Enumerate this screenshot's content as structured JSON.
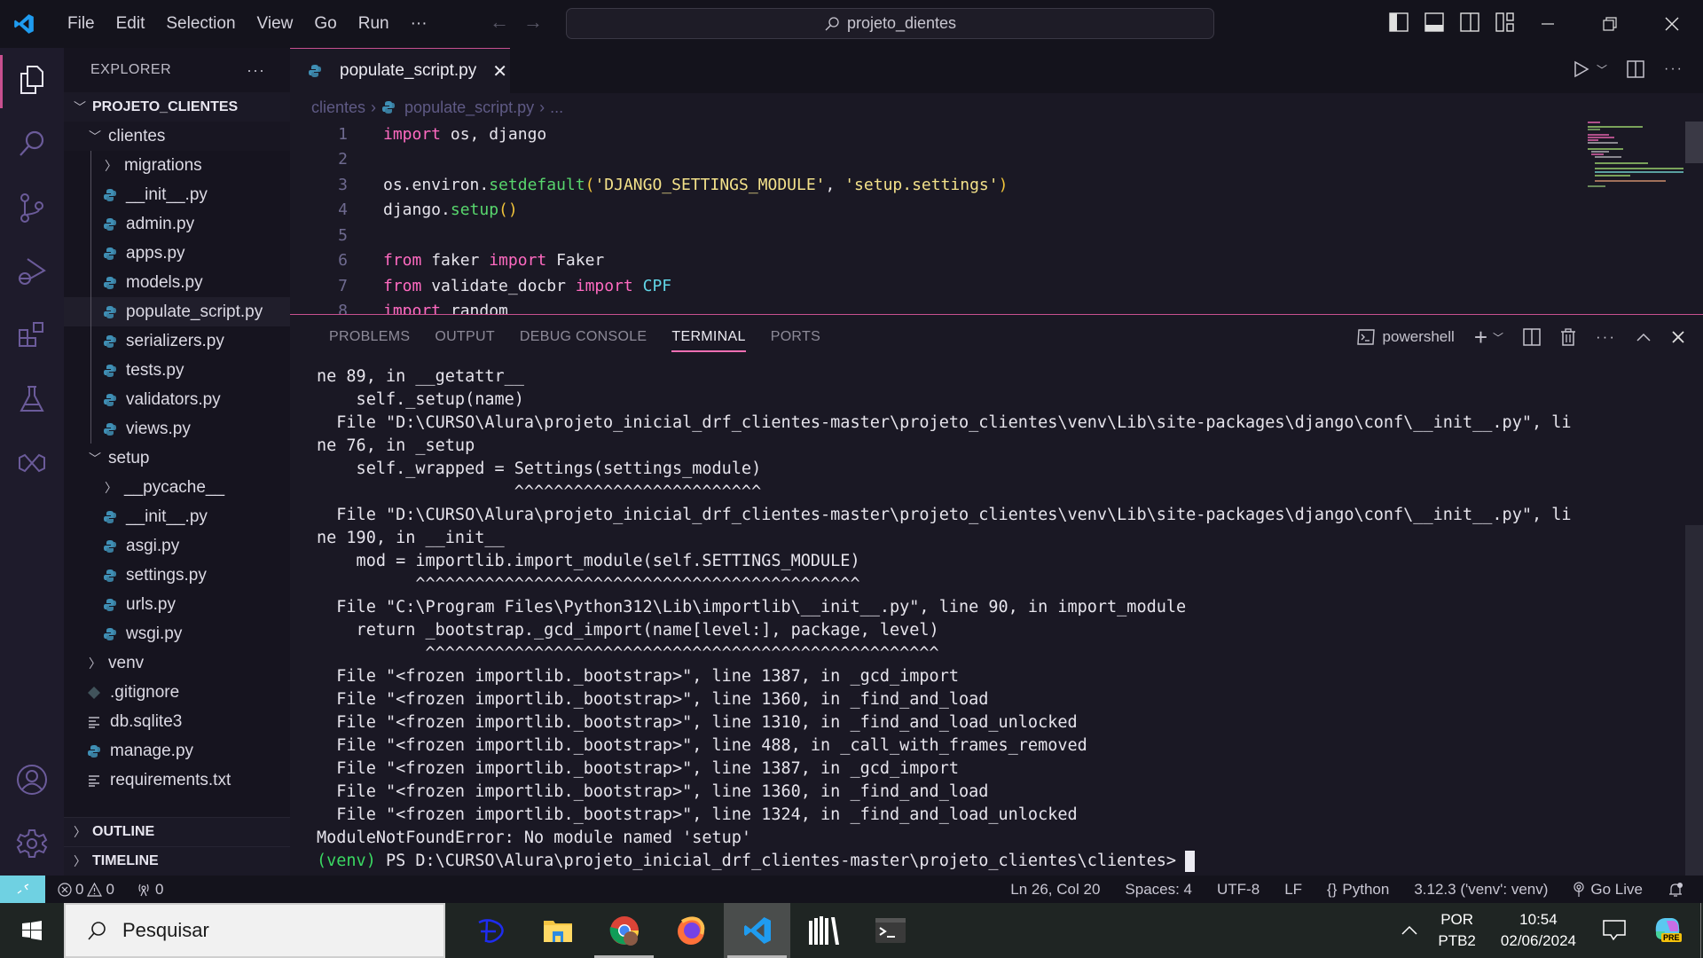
{
  "titlebar": {
    "menu": [
      "File",
      "Edit",
      "Selection",
      "View",
      "Go",
      "Run",
      "···"
    ],
    "search_text": "projeto_dientes"
  },
  "sidebar": {
    "title": "EXPLORER",
    "more": "···",
    "project": "PROJETO_CLIENTES",
    "tree": [
      {
        "label": "clientes",
        "type": "folder-open",
        "level": 1
      },
      {
        "label": "migrations",
        "type": "folder-closed",
        "level": 2
      },
      {
        "label": "__init__.py",
        "type": "py",
        "level": 2
      },
      {
        "label": "admin.py",
        "type": "py",
        "level": 2
      },
      {
        "label": "apps.py",
        "type": "py",
        "level": 2
      },
      {
        "label": "models.py",
        "type": "py",
        "level": 2
      },
      {
        "label": "populate_script.py",
        "type": "py",
        "level": 2,
        "selected": true
      },
      {
        "label": "serializers.py",
        "type": "py",
        "level": 2
      },
      {
        "label": "tests.py",
        "type": "py",
        "level": 2
      },
      {
        "label": "validators.py",
        "type": "py",
        "level": 2
      },
      {
        "label": "views.py",
        "type": "py",
        "level": 2
      },
      {
        "label": "setup",
        "type": "folder-open",
        "level": 1
      },
      {
        "label": "__pycache__",
        "type": "folder-closed",
        "level": 2
      },
      {
        "label": "__init__.py",
        "type": "py",
        "level": 2
      },
      {
        "label": "asgi.py",
        "type": "py",
        "level": 2
      },
      {
        "label": "settings.py",
        "type": "py",
        "level": 2
      },
      {
        "label": "urls.py",
        "type": "py",
        "level": 2
      },
      {
        "label": "wsgi.py",
        "type": "py",
        "level": 2
      },
      {
        "label": "venv",
        "type": "folder-closed",
        "level": 1
      },
      {
        "label": ".gitignore",
        "type": "git",
        "level": 1
      },
      {
        "label": "db.sqlite3",
        "type": "txt",
        "level": 1
      },
      {
        "label": "manage.py",
        "type": "py",
        "level": 1
      },
      {
        "label": "requirements.txt",
        "type": "txt",
        "level": 1
      }
    ],
    "outline": "OUTLINE",
    "timeline": "TIMELINE"
  },
  "editor": {
    "tab_label": "populate_script.py",
    "breadcrumb": [
      "clientes",
      "populate_script.py",
      "..."
    ],
    "lines": [
      {
        "n": "1",
        "html": "<span class='kw'>import</span> os, django"
      },
      {
        "n": "2",
        "html": ""
      },
      {
        "n": "3",
        "html": "os.environ.<span class='fn'>setdefault</span><span class='paren'>(</span><span class='str'>'DJANGO_SETTINGS_MODULE'</span>, <span class='str'>'setup.settings'</span><span class='paren'>)</span>"
      },
      {
        "n": "4",
        "html": "django.<span class='fn'>setup</span><span class='paren'>()</span>"
      },
      {
        "n": "5",
        "html": ""
      },
      {
        "n": "6",
        "html": "<span class='kw'>from</span> faker <span class='kw'>import</span> Faker"
      },
      {
        "n": "7",
        "html": "<span class='kw'>from</span> validate_docbr <span class='kw'>import</span> <span class='cls'>CPF</span>"
      },
      {
        "n": "8",
        "html": "<span class='kw'>import</span> random"
      }
    ]
  },
  "panel": {
    "tabs": [
      "PROBLEMS",
      "OUTPUT",
      "DEBUG CONSOLE",
      "TERMINAL",
      "PORTS"
    ],
    "active_tab": "TERMINAL",
    "shell": "powershell",
    "terminal_lines": [
      "ne 89, in __getattr__",
      "    self._setup(name)",
      "  File \"D:\\CURSO\\Alura\\projeto_inicial_drf_clientes-master\\projeto_clientes\\venv\\Lib\\site-packages\\django\\conf\\__init__.py\", li",
      "ne 76, in _setup",
      "    self._wrapped = Settings(settings_module)",
      "                    ^^^^^^^^^^^^^^^^^^^^^^^^^",
      "  File \"D:\\CURSO\\Alura\\projeto_inicial_drf_clientes-master\\projeto_clientes\\venv\\Lib\\site-packages\\django\\conf\\__init__.py\", li",
      "ne 190, in __init__",
      "    mod = importlib.import_module(self.SETTINGS_MODULE)",
      "          ^^^^^^^^^^^^^^^^^^^^^^^^^^^^^^^^^^^^^^^^^^^^^",
      "  File \"C:\\Program Files\\Python312\\Lib\\importlib\\__init__.py\", line 90, in import_module",
      "    return _bootstrap._gcd_import(name[level:], package, level)",
      "           ^^^^^^^^^^^^^^^^^^^^^^^^^^^^^^^^^^^^^^^^^^^^^^^^^^^^",
      "  File \"<frozen importlib._bootstrap>\", line 1387, in _gcd_import",
      "  File \"<frozen importlib._bootstrap>\", line 1360, in _find_and_load",
      "  File \"<frozen importlib._bootstrap>\", line 1310, in _find_and_load_unlocked",
      "  File \"<frozen importlib._bootstrap>\", line 488, in _call_with_frames_removed",
      "  File \"<frozen importlib._bootstrap>\", line 1387, in _gcd_import",
      "  File \"<frozen importlib._bootstrap>\", line 1360, in _find_and_load",
      "  File \"<frozen importlib._bootstrap>\", line 1324, in _find_and_load_unlocked",
      "ModuleNotFoundError: No module named 'setup'"
    ],
    "prompt_venv": "(venv)",
    "prompt_path": " PS D:\\CURSO\\Alura\\projeto_inicial_drf_clientes-master\\projeto_clientes\\clientes>"
  },
  "statusbar": {
    "errors": "0",
    "warnings": "0",
    "ports": "0",
    "position": "Ln 26, Col 20",
    "spaces": "Spaces: 4",
    "encoding": "UTF-8",
    "eol": "LF",
    "language": "Python",
    "interpreter": "3.12.3 ('venv': venv)",
    "golive": "Go Live"
  },
  "taskbar": {
    "search_placeholder": "Pesquisar",
    "lang_top": "POR",
    "lang_bottom": "PTB2",
    "time": "10:54",
    "date": "02/06/2024",
    "copilot_badge": "PRE"
  },
  "colors": {
    "accent": "#c8508f",
    "remote": "#6fd1e2",
    "keyword": "#ff6ac1",
    "function": "#58d66d",
    "string": "#f3e18a"
  }
}
